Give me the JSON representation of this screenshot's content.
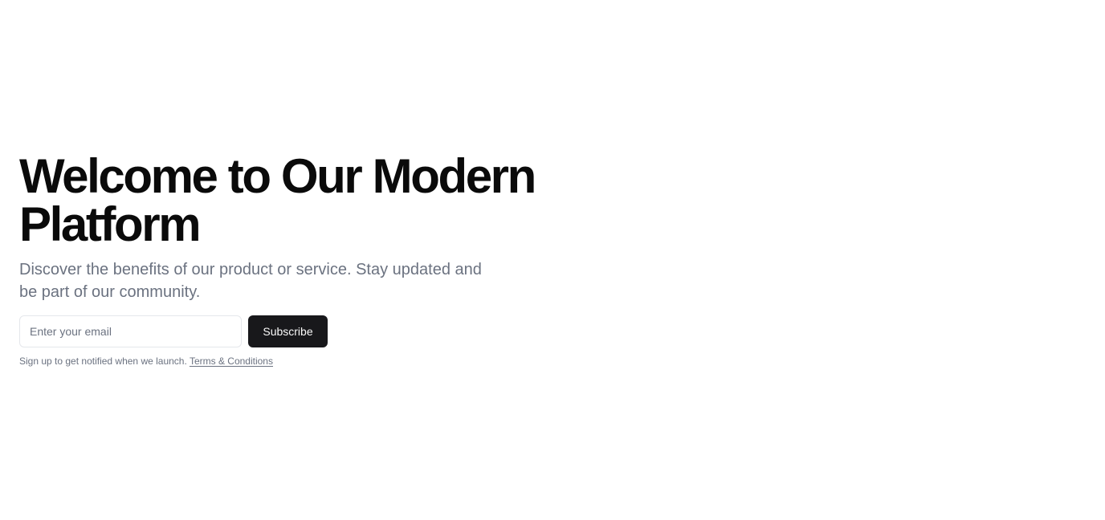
{
  "hero": {
    "title": "Welcome to Our Modern Platform",
    "subtitle": "Discover the benefits of our product or service. Stay updated and be part of our community."
  },
  "signup": {
    "email_placeholder": "Enter your email",
    "email_value": "",
    "subscribe_label": "Subscribe",
    "note_text": "Sign up to get notified when we launch.",
    "terms_link_label": "Terms & Conditions"
  },
  "colors": {
    "background": "#ffffff",
    "title": "#0a0a0a",
    "muted_text": "#6b7280",
    "button_bg": "#18181b",
    "button_text": "#fafafa",
    "input_border": "#e5e7eb"
  }
}
